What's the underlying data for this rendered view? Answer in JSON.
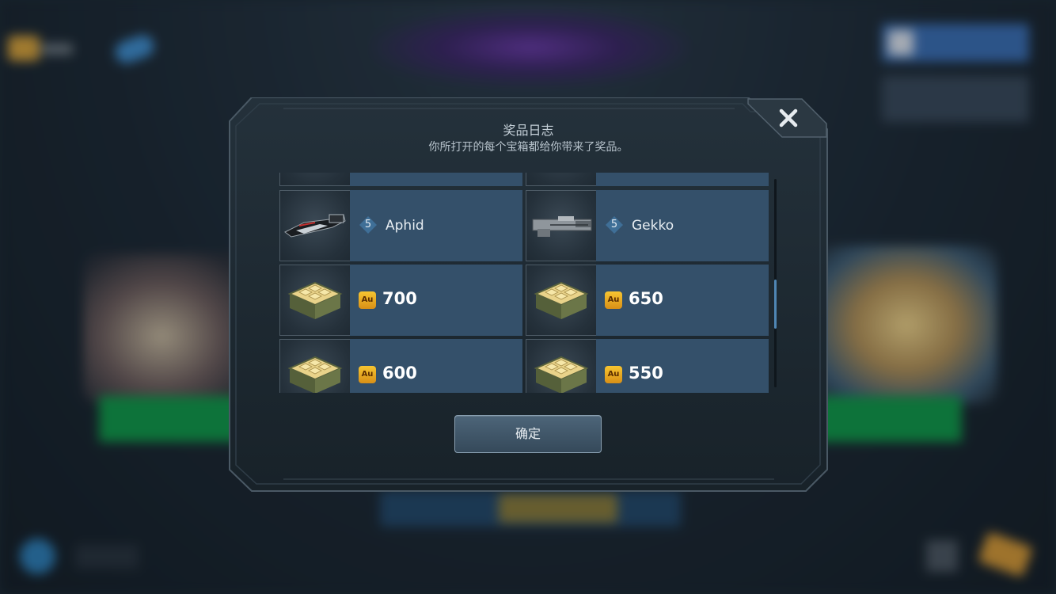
{
  "dialog": {
    "title": "奖品日志",
    "subtitle": "你所打开的每个宝箱都给你带来了奖品。",
    "confirm_label": "确定"
  },
  "rewards": [
    {
      "type": "weapon",
      "level": "5",
      "name": "Aphid",
      "icon": "aphid-weapon-icon"
    },
    {
      "type": "weapon",
      "level": "5",
      "name": "Gekko",
      "icon": "gekko-weapon-icon"
    },
    {
      "type": "gold",
      "currency": "Au",
      "amount": "700",
      "icon": "gold-crate-icon"
    },
    {
      "type": "gold",
      "currency": "Au",
      "amount": "650",
      "icon": "gold-crate-icon"
    },
    {
      "type": "gold",
      "currency": "Au",
      "amount": "600",
      "icon": "gold-crate-icon"
    },
    {
      "type": "gold",
      "currency": "Au",
      "amount": "550",
      "icon": "gold-crate-icon"
    }
  ],
  "scroll": {
    "position": 0.5
  },
  "colors": {
    "panel": "#1b252d",
    "cell": "#34506a",
    "accent": "#4f86b4",
    "gold": "#f2b42a"
  }
}
